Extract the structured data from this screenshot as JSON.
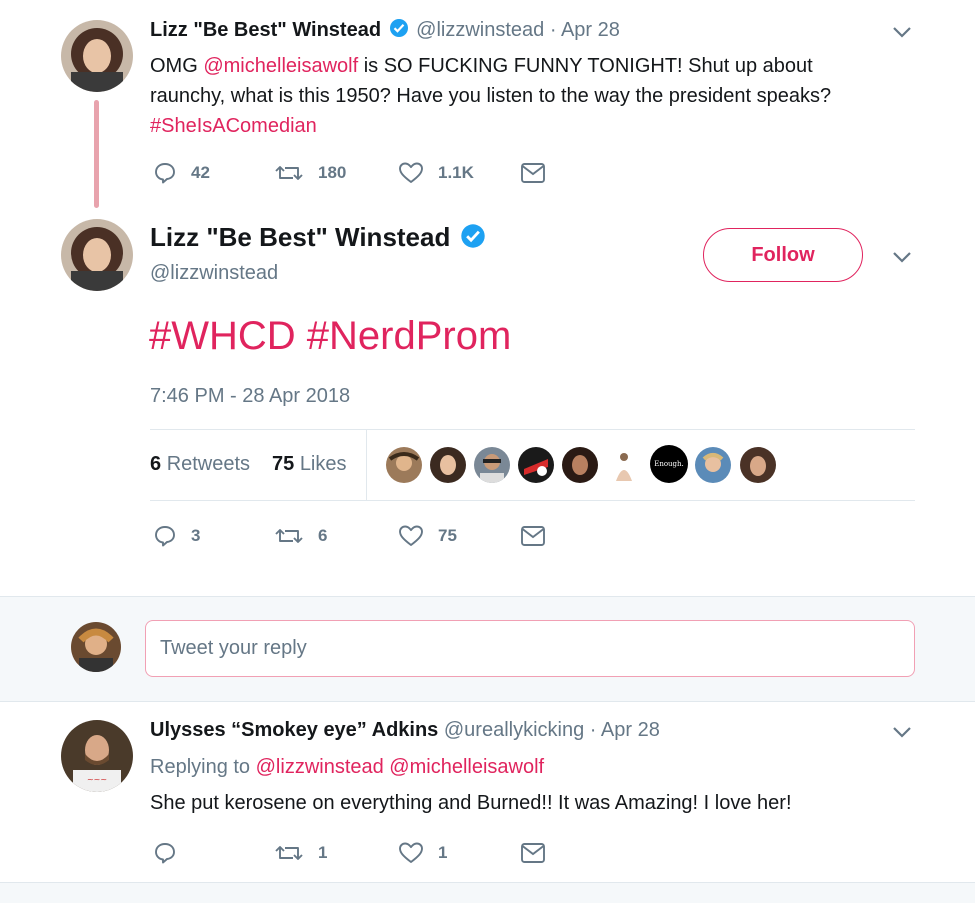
{
  "tweet1": {
    "name": "Lizz \"Be Best\" Winstead",
    "handle_date": "@lizzwinstead · Apr 28",
    "text_pre": "OMG ",
    "mention": "@michelleisawolf",
    "text_mid": " is SO FUCKING FUNNY TONIGHT! Shut up about",
    "text_line2": "raunchy, what is this 1950? Have you listen to the way the president speaks?",
    "hashtag": "#SheIsAComedian",
    "replies": "42",
    "retweets": "180",
    "likes": "1.1K"
  },
  "main_tweet": {
    "name": "Lizz \"Be Best\" Winstead",
    "handle": "@lizzwinstead",
    "follow_label": "Follow",
    "text": "#WHCD #NerdProm",
    "timestamp": "7:46 PM - 28 Apr 2018",
    "retweet_count": "6",
    "retweet_label": "Retweets",
    "like_count": "75",
    "like_label": "Likes",
    "liker_avatar_enough": "Enough.",
    "replies": "3",
    "retweets": "6",
    "likes": "75"
  },
  "reply_box": {
    "placeholder": "Tweet your reply"
  },
  "reply_tweet": {
    "name": "Ulysses “Smokey eye” Adkins",
    "handle_date": "@ureallykicking · Apr 28",
    "replying_label": "Replying to",
    "replying_mentions": "@lizzwinstead @michelleisawolf",
    "text": "She put kerosene on everything and Burned!! It was Amazing! I love her!",
    "replies": "",
    "retweets": "1",
    "likes": "1"
  },
  "colors": {
    "accent_red": "#e0245e",
    "verified_blue": "#1da1f2",
    "muted": "#657786"
  }
}
